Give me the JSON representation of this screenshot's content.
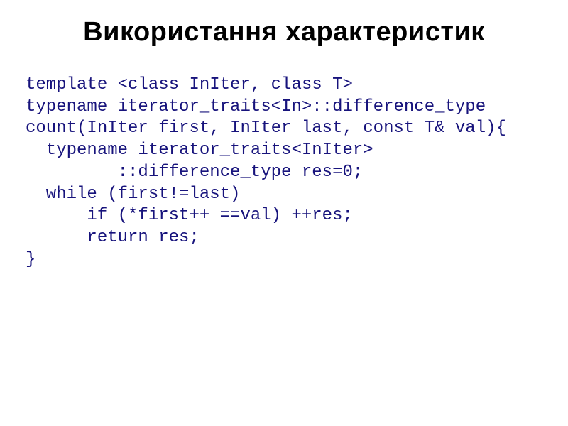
{
  "slide": {
    "title": "Використання характеристик",
    "code": {
      "l1": "template <class InIter, class T>",
      "l2": "typename iterator_traits<In>::difference_type",
      "l3": "count(InIter first, InIter last, const T& val){",
      "l4": "  typename iterator_traits<InIter>",
      "l5": "         ::difference_type res=0;",
      "l6": "  while (first!=last)",
      "l7": "      if (*first++ ==val) ++res;",
      "l8": "      return res;",
      "l9": "}"
    }
  }
}
